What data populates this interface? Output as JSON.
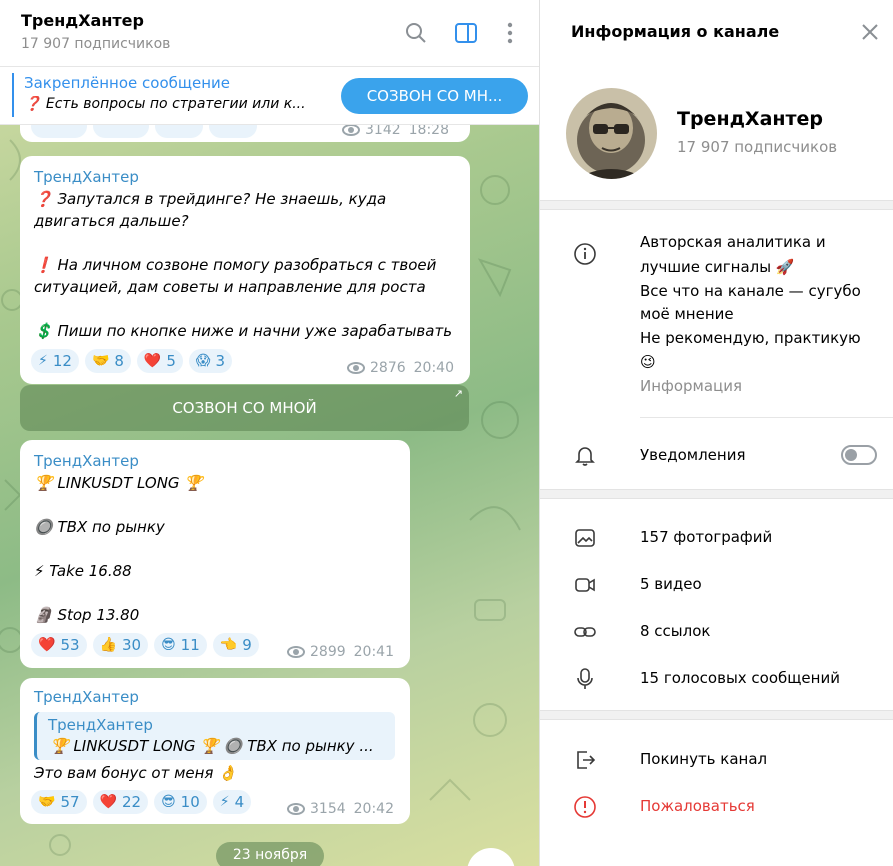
{
  "chat": {
    "title": "ТрендХантер",
    "subscribers": "17 907 подписчиков",
    "pinned": {
      "title": "Закреплённое сообщение",
      "text": "❓ Есть вопросы по стратегии или к...",
      "button": "СОЗВОН СО МН..."
    },
    "top_partial": {
      "views": "3142",
      "time": "18:28"
    },
    "messages": [
      {
        "author": "ТрендХантер",
        "lines": [
          "❓ Запутался в трейдинге? Не знаешь, куда",
          "двигаться дальше?",
          "",
          "❗ На личном созвоне помогу разобраться с твоей",
          "ситуацией, дам советы и направление для роста",
          "",
          "💲 Пиши по кнопке ниже и начни уже зарабатывать"
        ],
        "reactions": [
          {
            "emoji": "⚡",
            "count": "12"
          },
          {
            "emoji": "🤝",
            "count": "8"
          },
          {
            "emoji": "❤️",
            "count": "5"
          },
          {
            "emoji": "😱",
            "count": "3"
          }
        ],
        "views": "2876",
        "time": "20:40",
        "inline_button": "СОЗВОН СО МНОЙ",
        "inline_arrow": "↗"
      },
      {
        "author": "ТрендХантер",
        "lines": [
          "🏆 LINKUSDT LONG 🏆",
          "",
          "🔘 ТВХ по рынку",
          "",
          "⚡ Take 16.88",
          "",
          "🗿 Stop 13.80"
        ],
        "reactions": [
          {
            "emoji": "❤️",
            "count": "53"
          },
          {
            "emoji": "👍",
            "count": "30"
          },
          {
            "emoji": "😎",
            "count": "11"
          },
          {
            "emoji": "👈",
            "count": "9"
          }
        ],
        "views": "2899",
        "time": "20:41"
      },
      {
        "author": "ТрендХантер",
        "quote_author": "ТрендХантер",
        "quote_text": "🏆 LINKUSDT LONG 🏆  🔘 ТВХ по рынку  ...",
        "text": "Это вам бонус от меня 👌",
        "reactions": [
          {
            "emoji": "🤝",
            "count": "57"
          },
          {
            "emoji": "❤️",
            "count": "22"
          },
          {
            "emoji": "😎",
            "count": "10"
          },
          {
            "emoji": "⚡",
            "count": "4"
          }
        ],
        "views": "3154",
        "time": "20:42"
      }
    ],
    "date_chip": "23 ноября"
  },
  "info": {
    "title": "Информация о канале",
    "channel_name": "ТрендХантер",
    "subscribers": "17 907 подписчиков",
    "description": [
      "Авторская аналитика и",
      "лучшие сигналы 🚀",
      "Все что на канале — сугубо",
      "моё мнение",
      "Не рекомендую, практикую",
      "😉"
    ],
    "description_caption": "Информация",
    "notifications_label": "Уведомления",
    "notifications_on": false,
    "media": [
      {
        "icon": "photo-icon",
        "label": "157 фотографий"
      },
      {
        "icon": "video-icon",
        "label": "5 видео"
      },
      {
        "icon": "link-icon",
        "label": "8 ссылок"
      },
      {
        "icon": "mic-icon",
        "label": "15 голосовых сообщений"
      }
    ],
    "leave_label": "Покинуть канал",
    "report_label": "Пожаловаться"
  }
}
